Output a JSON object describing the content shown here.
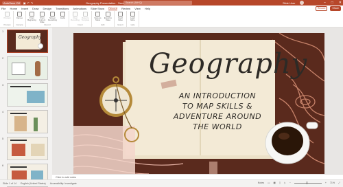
{
  "titlebar": {
    "autosave": "AutoSave",
    "autosave_state": "Off",
    "document": "Geography Presentation",
    "status": "Saved",
    "search_placeholder": "Search (Alt+Q)",
    "user": "Slide User",
    "wc_min": "–",
    "wc_max": "□",
    "wc_close": "✕"
  },
  "menu": {
    "tabs": [
      "File",
      "Home",
      "Insert",
      "Draw",
      "Design",
      "Transitions",
      "Animations",
      "Slide Show",
      "Record",
      "Review",
      "View",
      "Help"
    ],
    "active_index": 8,
    "record": "Record",
    "share": "Share"
  },
  "ribbon": {
    "groups": [
      {
        "label": "Preview",
        "buttons": [
          {
            "label": "Preview",
            "dim": true
          }
        ]
      },
      {
        "label": "Camera",
        "buttons": [
          {
            "label": "Cameo",
            "dim": false
          }
        ]
      },
      {
        "label": "Record",
        "buttons": [
          {
            "label": "From Beginning",
            "dim": false
          },
          {
            "label": "From Current Slide",
            "dim": false
          },
          {
            "label": "Screen Recording",
            "dim": false
          },
          {
            "label": "Audio",
            "dim": false
          }
        ]
      },
      {
        "label": "Insert",
        "buttons": [
          {
            "label": "Clear Recording",
            "dim": true
          },
          {
            "label": "Reset to Template",
            "dim": true
          }
        ]
      },
      {
        "label": "Edit",
        "buttons": [
          {
            "label": "Save as Show",
            "dim": false
          },
          {
            "label": "Export to Video",
            "dim": false
          }
        ]
      },
      {
        "label": "Export",
        "buttons": [
          {
            "label": "Insert Video",
            "dim": false
          }
        ]
      },
      {
        "label": "Help",
        "buttons": [
          {
            "label": "Learn More",
            "dim": false
          }
        ]
      }
    ]
  },
  "slides": [
    {
      "num": "1",
      "title": "Geography"
    },
    {
      "num": "2",
      "title": "Learning objectives"
    },
    {
      "num": "3",
      "title": "What is a map?"
    },
    {
      "num": "4",
      "title": "Parts of a map"
    },
    {
      "num": "5",
      "title": "Parts of a map"
    },
    {
      "num": "6",
      "title": "Parts of a map"
    }
  ],
  "main_slide": {
    "title": "Geography",
    "subtitle_lines": [
      "AN INTRODUCTION",
      "TO MAP SKILLS &",
      "ADVENTURE AROUND",
      "THE WORLD"
    ]
  },
  "notes": {
    "placeholder": "Click to add notes"
  },
  "status": {
    "slide": "Slide 1 of 14",
    "language": "English (United States)",
    "accessibility": "Accessibility: Investigate",
    "notes_btn": "Notes",
    "zoom": "71%"
  },
  "colors": {
    "accent": "#b7472a",
    "slide_bg": "#5a2a1d",
    "paper": "#f3ead6"
  }
}
